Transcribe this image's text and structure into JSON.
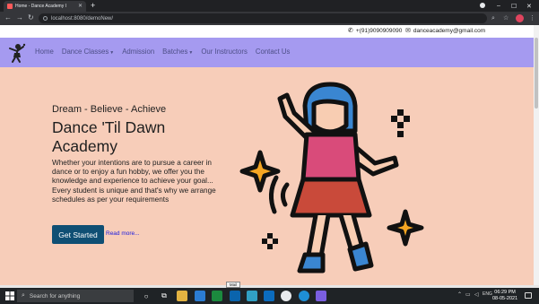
{
  "browser": {
    "tab_title": "Home - Dance Academy I",
    "url": "localhost:8080/demoNew/"
  },
  "site": {
    "phone": "+(91)9090909090",
    "email": "danceacademy@gmail.com",
    "nav": [
      {
        "label": "Home"
      },
      {
        "label": "Dance Classes",
        "dropdown": true
      },
      {
        "label": "Admission"
      },
      {
        "label": "Batches",
        "dropdown": true
      },
      {
        "label": "Our Instructors"
      },
      {
        "label": "Contact Us"
      }
    ],
    "hero": {
      "tagline": "Dream - Believe - Achieve",
      "headline": "Dance 'Til Dawn Academy",
      "description_1": "Whether your intentions are to pursue a career in dance or to enjoy a fun hobby, we offer you the knowledge and experience to achieve your goal...",
      "description_2": "Every student is unique and that's why we arrange schedules as per your requirements",
      "cta_label": "Get Started",
      "read_more": "Read more..."
    },
    "colors": {
      "navbar": "#a59af0",
      "hero_bg": "#f7cdb9",
      "cta": "#0f4f74"
    }
  },
  "tooltip": "Mail",
  "taskbar": {
    "search_placeholder": "Search for anything",
    "language": "ENG",
    "time": "06:29 PM",
    "date": "08-05-2021"
  }
}
